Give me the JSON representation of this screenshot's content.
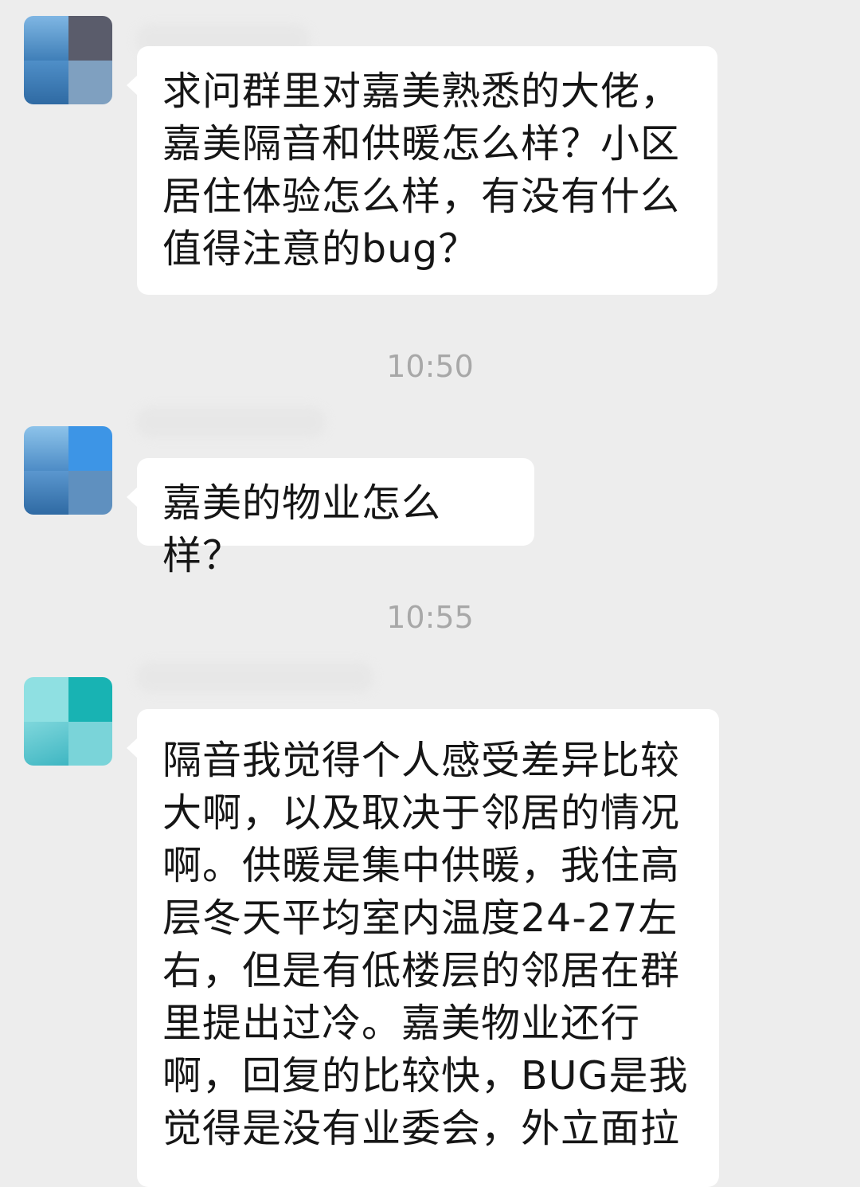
{
  "messages": [
    {
      "text": "求问群里对嘉美熟悉的大佬，嘉美隔音和供暖怎么样？小区居住体验怎么样，有没有什么值得注意的bug？"
    },
    {
      "text": "嘉美的物业怎么样？"
    },
    {
      "text": "隔音我觉得个人感受差异比较大啊，以及取决于邻居的情况啊。供暖是集中供暖，我住高层冬天平均室内温度24-27左右，但是有低楼层的邻居在群里提出过冷。嘉美物业还行啊，回复的比较快，BUG是我觉得是没有业委会，外立面拉"
    }
  ],
  "timestamps": [
    "10:50",
    "10:55"
  ],
  "colors": {
    "background": "#ededed",
    "bubble": "#ffffff",
    "text": "#161616",
    "timestamp": "#a8a8a8"
  }
}
